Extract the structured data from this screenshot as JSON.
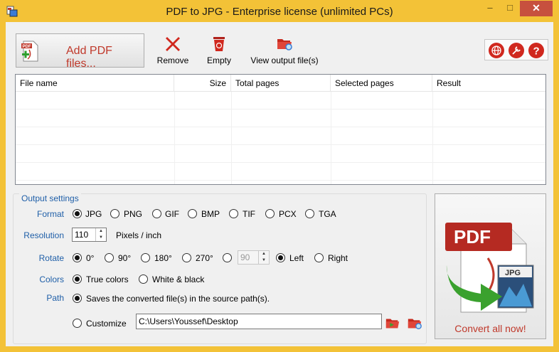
{
  "window": {
    "title": "PDF to JPG - Enterprise license (unlimited PCs)",
    "min_glyph": "‒",
    "max_glyph": "□",
    "close_glyph": "✕"
  },
  "toolbar": {
    "add_label": "Add PDF files...",
    "remove_label": "Remove",
    "empty_label": "Empty",
    "view_label": "View output file(s)",
    "icons": [
      "pdf-add-icon",
      "remove-x-icon",
      "recycle-bin-icon",
      "folder-view-icon",
      "globe-icon",
      "settings-icon",
      "help-icon"
    ]
  },
  "file_list": {
    "columns": [
      "File name",
      "Size",
      "Total pages",
      "Selected pages",
      "Result"
    ],
    "rows": []
  },
  "output_settings": {
    "title": "Output settings",
    "format": {
      "label": "Format",
      "options": [
        "JPG",
        "PNG",
        "GIF",
        "BMP",
        "TIF",
        "PCX",
        "TGA"
      ],
      "selected": "JPG"
    },
    "resolution": {
      "label": "Resolution",
      "value": "110",
      "unit": "Pixels / inch"
    },
    "rotate": {
      "label": "Rotate",
      "options": [
        "0°",
        "90°",
        "180°",
        "270°"
      ],
      "selected": "0°",
      "custom_value": "90",
      "direction_options": [
        "Left",
        "Right"
      ],
      "direction_selected": "Left"
    },
    "colors": {
      "label": "Colors",
      "options": [
        "True colors",
        "White & black"
      ],
      "selected": "True colors"
    },
    "path": {
      "label": "Path",
      "source_option": "Saves the converted file(s) in the source path(s).",
      "customize_option": "Customize",
      "custom_path": "C:\\Users\\Youssef\\Desktop"
    }
  },
  "convert": {
    "label": "Convert all now!",
    "badge_pdf": "PDF",
    "badge_jpg": "JPG"
  },
  "colors": {
    "titlebar": "#f3c237",
    "accent_red": "#c0392b",
    "label_blue": "#1f5fa8"
  }
}
